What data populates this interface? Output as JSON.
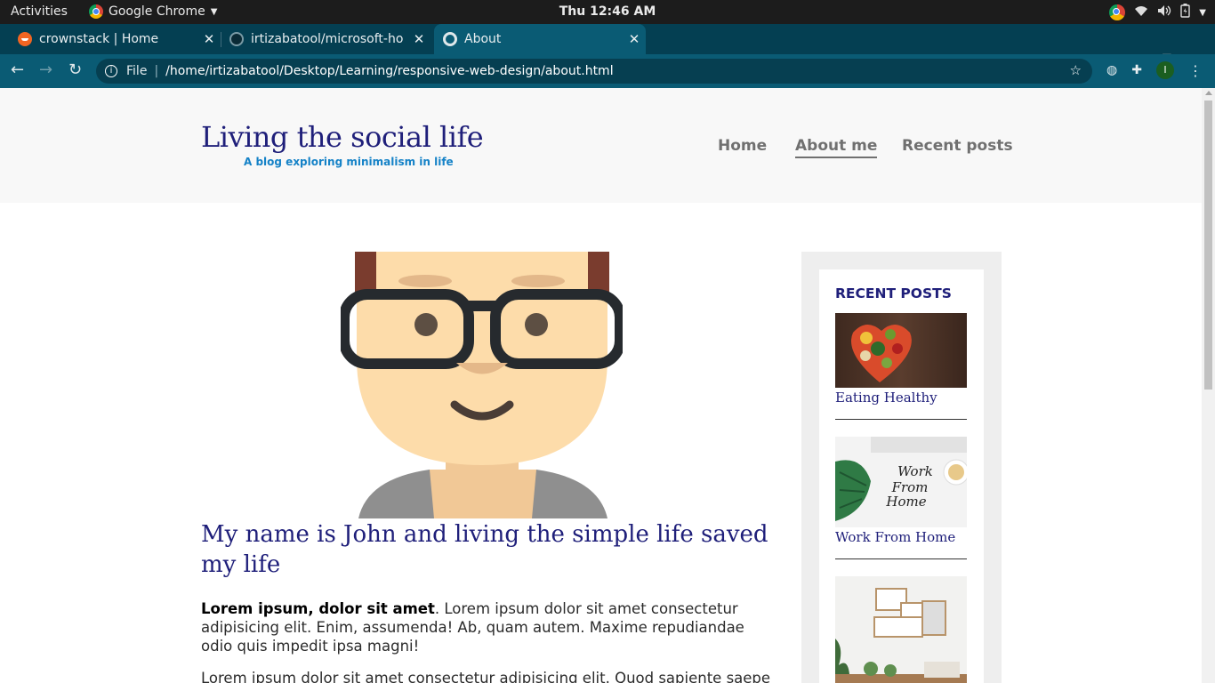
{
  "system": {
    "activities": "Activities",
    "app_name": "Google Chrome",
    "clock": "Thu 12:46 AM"
  },
  "browser": {
    "tabs": [
      {
        "title": "crownstack | Home",
        "favicon": "crownstack-icon",
        "active": false
      },
      {
        "title": "irtizabatool/microsoft-ho",
        "favicon": "github-icon",
        "active": false
      },
      {
        "title": "About",
        "favicon": "globe-icon",
        "active": true
      }
    ],
    "omnibox": {
      "scheme_label": "File",
      "url": "/home/irtizabatool/Desktop/Learning/responsive-web-design/about.html"
    },
    "profile_initial": "I"
  },
  "site": {
    "title": "Living the social life",
    "subtitle": "A blog exploring minimalism in life",
    "nav": [
      {
        "label": "Home",
        "current": false
      },
      {
        "label": "About me",
        "current": true
      },
      {
        "label": "Recent posts",
        "current": false
      }
    ]
  },
  "main": {
    "heading": "My name is John and living the simple life saved my life",
    "para1_bold": "Lorem ipsum, dolor sit amet",
    "para1_rest": ". Lorem ipsum dolor sit amet consectetur adipisicing elit. Enim, assumenda! Ab, quam autem. Maxime repudiandae odio quis impedit ipsa magni!",
    "para2": "Lorem ipsum dolor sit amet consectetur adipisicing elit. Quod sapiente saepe"
  },
  "sidebar": {
    "heading": "RECENT POSTS",
    "posts": [
      {
        "caption": "Eating Healthy"
      },
      {
        "caption": "Work From Home"
      },
      {
        "caption": ""
      }
    ]
  },
  "colors": {
    "brand_navy": "#1f1f7a",
    "subtitle_blue": "#1582c7",
    "chrome_tab_bg": "#043f52",
    "chrome_toolbar": "#0a5b74"
  }
}
